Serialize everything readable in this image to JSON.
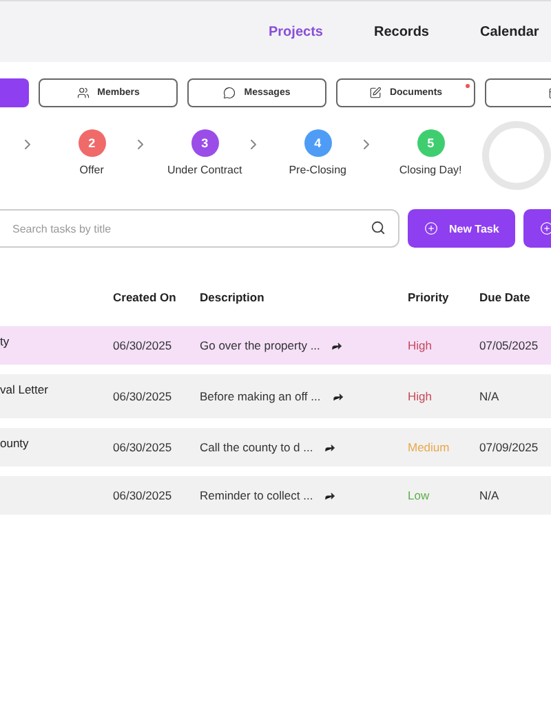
{
  "nav": [
    {
      "label": "Projects",
      "selected": true
    },
    {
      "label": "Records",
      "selected": false
    },
    {
      "label": "Calendar",
      "selected": false
    }
  ],
  "toolbar": [
    {
      "kind": "primary"
    },
    {
      "kind": "members",
      "label": "Members"
    },
    {
      "kind": "messages",
      "label": "Messages"
    },
    {
      "kind": "documents",
      "label": "Documents",
      "badge": true
    },
    {
      "kind": "calendar"
    }
  ],
  "steps": [
    {
      "number": "2",
      "label": "Offer",
      "color": "#f06a6a"
    },
    {
      "number": "3",
      "label": "Under Contract",
      "color": "#9b4de8"
    },
    {
      "number": "4",
      "label": "Pre-Closing",
      "color": "#4e9cf5"
    },
    {
      "number": "5",
      "label": "Closing Day!",
      "color": "#3fce6f"
    }
  ],
  "search": {
    "placeholder": "Search tasks by title"
  },
  "actions": [
    {
      "kind": "new",
      "label": "New Task"
    },
    {
      "kind": "add"
    }
  ],
  "table": {
    "columns": [
      "",
      "Created On",
      "Description",
      "Priority",
      "Due Date"
    ],
    "rows": [
      {
        "title": "ty",
        "created": "06/30/2025",
        "description": "Go over the property ...",
        "priority": "High",
        "color": "#c9475a",
        "due": "07/05/2025",
        "selected": true
      },
      {
        "title": "val Letter",
        "created": "06/30/2025",
        "description": "Before making an off ...",
        "priority": "High",
        "color": "#c9475a",
        "due": "N/A",
        "selected": false
      },
      {
        "title": "ounty",
        "created": "06/30/2025",
        "description": "Call the county to d ...",
        "priority": "Medium",
        "color": "#e9a84a",
        "due": "07/09/2025",
        "selected": false
      },
      {
        "created": "06/30/2025",
        "description": "Reminder to collect ...",
        "priority": "Low",
        "color": "#5ab04a",
        "due": "N/A",
        "selected": false
      }
    ]
  }
}
